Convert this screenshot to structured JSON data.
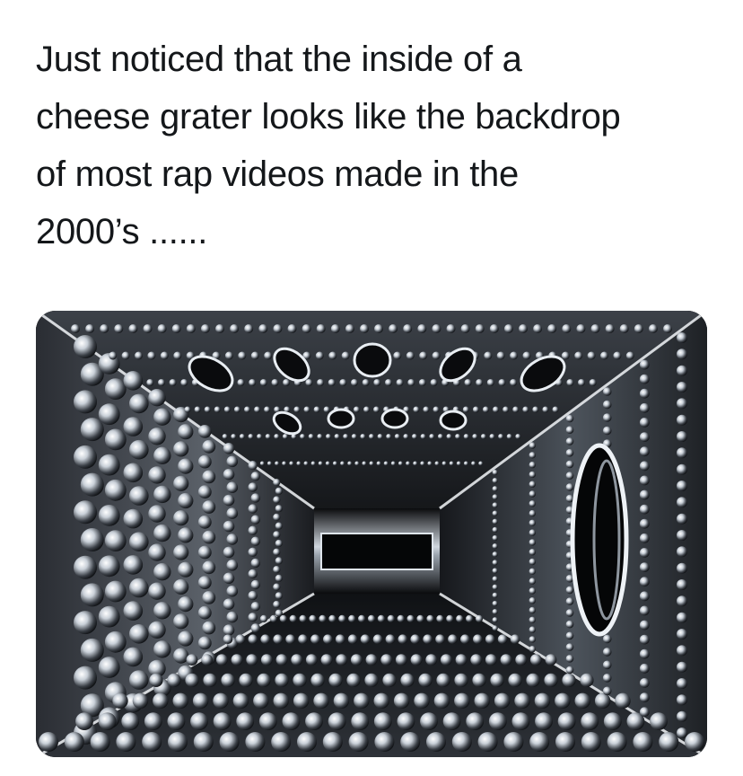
{
  "tweet": {
    "text": "Just noticed that the inside of a\ncheese grater looks like the backdrop\nof most rap videos made in the\n2000’s ......"
  },
  "media": {
    "subject": "inside of a cheese grater",
    "colors": {
      "background": "#0c0d10",
      "metal_light": "#e8edf2",
      "metal_dark": "#1a1c20"
    }
  }
}
